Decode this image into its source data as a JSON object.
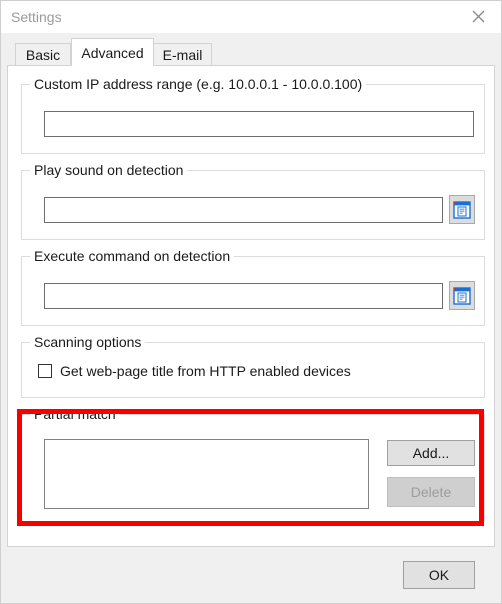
{
  "window": {
    "title": "Settings",
    "close_icon": "close-icon"
  },
  "tabs": [
    {
      "id": "basic",
      "label": "Basic",
      "selected": false
    },
    {
      "id": "advanced",
      "label": "Advanced",
      "selected": true
    },
    {
      "id": "email",
      "label": "E-mail",
      "selected": false
    }
  ],
  "groups": {
    "ip_range": {
      "label": "Custom IP address range (e.g. 10.0.0.1 - 10.0.0.100)",
      "input_value": "",
      "input_placeholder": ""
    },
    "play_sound": {
      "label": "Play sound on detection",
      "input_value": "",
      "input_placeholder": "",
      "browse_icon": "document-browse-icon"
    },
    "execute_command": {
      "label": "Execute command on detection",
      "input_value": "",
      "input_placeholder": "",
      "browse_icon": "document-browse-icon"
    },
    "scanning_options": {
      "label": "Scanning options",
      "checkbox_label": "Get web-page title from HTTP enabled devices",
      "checkbox_checked": false
    },
    "partial_match": {
      "label": "Partial match",
      "list_items": [],
      "add_label": "Add...",
      "delete_label": "Delete",
      "delete_disabled": true
    }
  },
  "footer": {
    "ok_label": "OK"
  },
  "annotation": {
    "highlight_color": "#f80000",
    "target": "partial-match-group"
  }
}
